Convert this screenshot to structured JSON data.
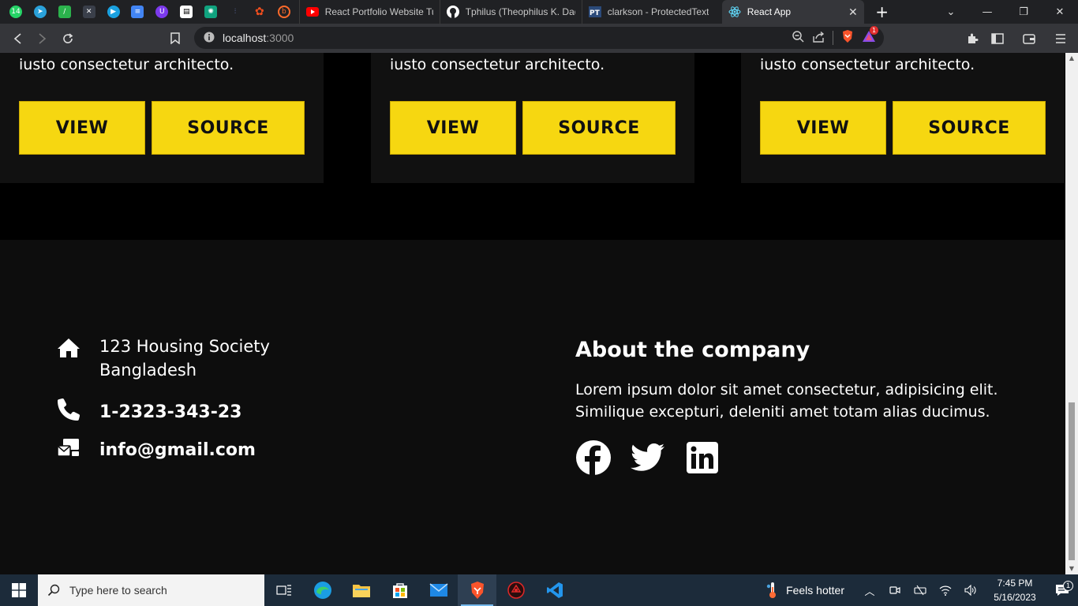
{
  "browser": {
    "pinned_tabs": [
      {
        "icon": "whatsapp-icon",
        "badge": "14",
        "color": "#25d366"
      },
      {
        "icon": "telegram-icon",
        "color": "#2aa1da"
      },
      {
        "icon": "feedly-icon",
        "color": "#2bb24c"
      },
      {
        "icon": "tools-icon",
        "color": "#3a3f4a"
      },
      {
        "icon": "player-icon",
        "color": "#1aa1e0"
      },
      {
        "icon": "docs-icon",
        "color": "#4285f4"
      },
      {
        "icon": "u-icon",
        "color": "#7c3aed"
      },
      {
        "icon": "notion-icon",
        "color": "#ffffff"
      },
      {
        "icon": "chatgpt-icon",
        "color": "#10a37f"
      },
      {
        "icon": "analytics-icon",
        "color": "#5a6ad8"
      },
      {
        "icon": "figma-icon",
        "color": "#f24e1e"
      },
      {
        "icon": "b-icon",
        "color": "#ff6b2b"
      }
    ],
    "tabs": [
      {
        "title": "React Portfolio Website Tut",
        "icon": "youtube-icon"
      },
      {
        "title": "Tphilus (Theophilus K. Dadz",
        "icon": "github-icon"
      },
      {
        "title": "clarkson - ProtectedText",
        "icon": "protectedtext-icon"
      },
      {
        "title": "React App",
        "icon": "react-icon",
        "active": true
      }
    ],
    "url_host": "localhost",
    "url_port": ":3000",
    "brave_badge": "1"
  },
  "projects": [
    {
      "desc": "iusto consectetur architecto.",
      "view": "VIEW",
      "source": "SOURCE"
    },
    {
      "desc": "iusto consectetur architecto.",
      "view": "VIEW",
      "source": "SOURCE"
    },
    {
      "desc": "iusto consectetur architecto.",
      "view": "VIEW",
      "source": "SOURCE"
    }
  ],
  "footer": {
    "address_line1": "123 Housing Society",
    "address_line2": "Bangladesh",
    "phone": "1-2323-343-23",
    "email": "info@gmail.com",
    "about_title": "About the company",
    "about_text": "Lorem ipsum dolor sit amet consectetur, adipisicing elit. Similique excepturi, deleniti amet totam alias ducimus."
  },
  "colors": {
    "accent": "#f6d711",
    "page_bg": "#000000",
    "card_bg": "#111111",
    "footer_bg": "#0d0d0d"
  },
  "taskbar": {
    "search_placeholder": "Type here to search",
    "weather": "Feels hotter",
    "time": "7:45 PM",
    "date": "5/16/2023",
    "notification_count": "1"
  }
}
